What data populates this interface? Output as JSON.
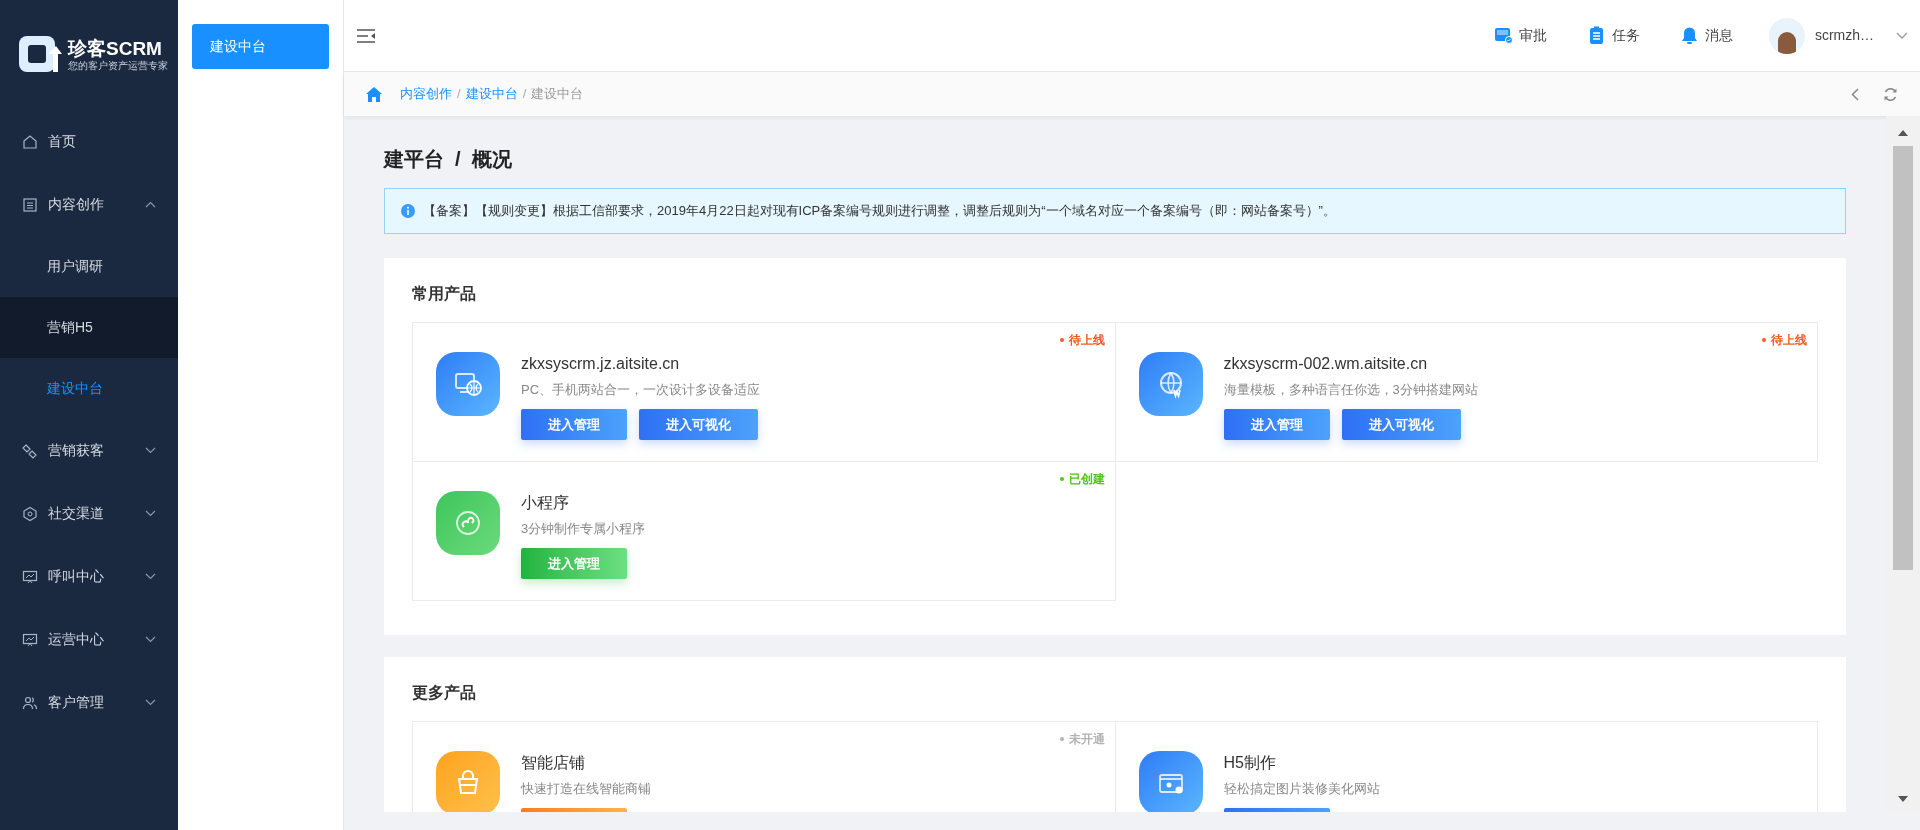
{
  "logo": {
    "name": "珍客SCRM",
    "tagline": "您的客户资产运营专家"
  },
  "sidebar": {
    "items": [
      {
        "label": "首页"
      },
      {
        "label": "内容创作",
        "expanded": true,
        "children": [
          {
            "label": "用户调研",
            "selected": false,
            "hovered": false
          },
          {
            "label": "营销H5",
            "selected": false,
            "hovered": true
          },
          {
            "label": "建设中台",
            "selected": true,
            "hovered": false
          }
        ]
      },
      {
        "label": "营销获客",
        "expanded": false
      },
      {
        "label": "社交渠道",
        "expanded": false
      },
      {
        "label": "呼叫中心",
        "expanded": false
      },
      {
        "label": "运营中心",
        "expanded": false
      },
      {
        "label": "客户管理",
        "expanded": false
      }
    ]
  },
  "submenu": {
    "items": [
      {
        "label": "建设中台",
        "selected": true
      }
    ]
  },
  "header": {
    "actions": [
      {
        "label": "审批"
      },
      {
        "label": "任务"
      },
      {
        "label": "消息"
      }
    ],
    "user": "scrmzh…"
  },
  "breadcrumb": [
    {
      "label": "内容创作",
      "link": true
    },
    {
      "separator": "/",
      "label": "建设中台",
      "link": true
    },
    {
      "separator": "/",
      "label": "建设中台",
      "link": false
    }
  ],
  "page_title": "建平台  /  概况",
  "notice": "【备案】【规则变更】根据工信部要求，2019年4月22日起对现有ICP备案编号规则进行调整，调整后规则为“一个域名对应一个备案编号（即：网站备案号）”。",
  "sections": [
    {
      "title": "常用产品",
      "products": [
        {
          "kind": "pc",
          "title": "zkxsyscrm.jz.aitsite.cn",
          "desc": "PC、手机两站合一，一次设计多设备适应",
          "status": "待上线",
          "color": "#fa5a1e",
          "buttons": [
            "进入管理",
            "进入可视化"
          ]
        },
        {
          "kind": "web",
          "title": "zkxsyscrm-002.wm.aitsite.cn",
          "desc": "海量模板，多种语言任你选，3分钟搭建网站",
          "status": "待上线",
          "color": "#fa5a1e",
          "buttons": [
            "进入管理",
            "进入可视化"
          ]
        },
        {
          "kind": "mini",
          "title": "小程序",
          "desc": "3分钟制作专属小程序",
          "status": "已创建",
          "color": "#52c41a",
          "buttons": [
            "进入管理"
          ]
        }
      ]
    },
    {
      "title": "更多产品",
      "products": [
        {
          "kind": "shop",
          "title": "智能店铺",
          "desc": "快速打造在线智能商铺",
          "status": "未开通",
          "color": "#b3b3b3",
          "button_stub": true
        },
        {
          "kind": "h5",
          "title": "H5制作",
          "desc": "轻松搞定图片装修美化网站",
          "button_stub": true
        }
      ]
    }
  ]
}
